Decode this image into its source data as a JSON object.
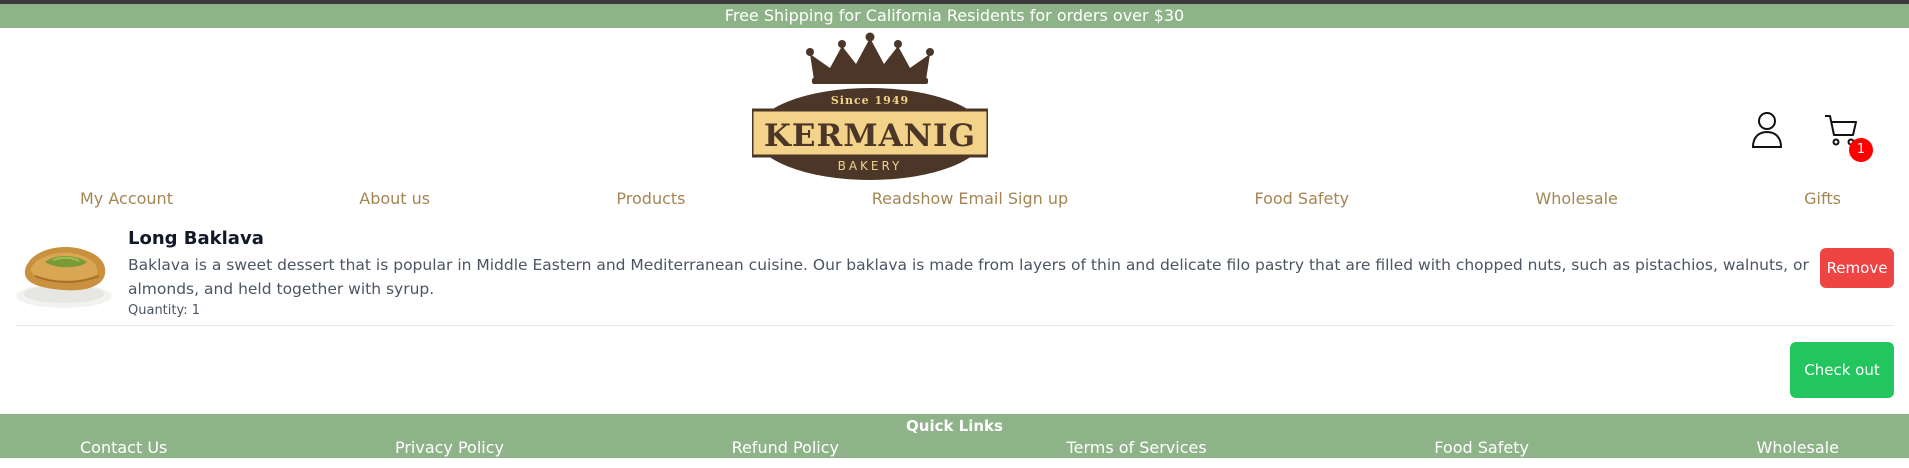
{
  "announcement": "Free Shipping for California Residents for orders over $30",
  "logo": {
    "since": "Since 1949",
    "name": "KERMANIG",
    "sub": "BAKERY"
  },
  "header": {
    "account_icon": "user-icon",
    "cart_icon": "cart-icon",
    "cart_count": "1"
  },
  "nav": {
    "items": [
      "My Account",
      "About us",
      "Products",
      "Readshow Email Sign up",
      "Food Safety",
      "Wholesale",
      "Gifts"
    ]
  },
  "cart": {
    "items": [
      {
        "title": "Long Baklava",
        "description": "Baklava is a sweet dessert that is popular in Middle Eastern and Mediterranean cuisine. Our baklava is made from layers of thin and delicate filo pastry that are filled with chopped nuts, such as pistachios, walnuts, or almonds, and held together with syrup.",
        "quantity": "Quantity: 1",
        "remove_label": "Remove"
      }
    ],
    "checkout_label": "Check out"
  },
  "footer": {
    "title": "Quick Links",
    "links": [
      "Contact Us",
      "Privacy Policy",
      "Refund Policy",
      "Terms of Services",
      "Food Safety",
      "Wholesale"
    ]
  },
  "colors": {
    "green_bar": "#8fb389",
    "nav_text": "#a58553",
    "logo_brown": "#4b3628",
    "logo_gold": "#f3d38a",
    "remove": "#ef4444",
    "checkout": "#22c55e",
    "badge": "#ff0000"
  }
}
